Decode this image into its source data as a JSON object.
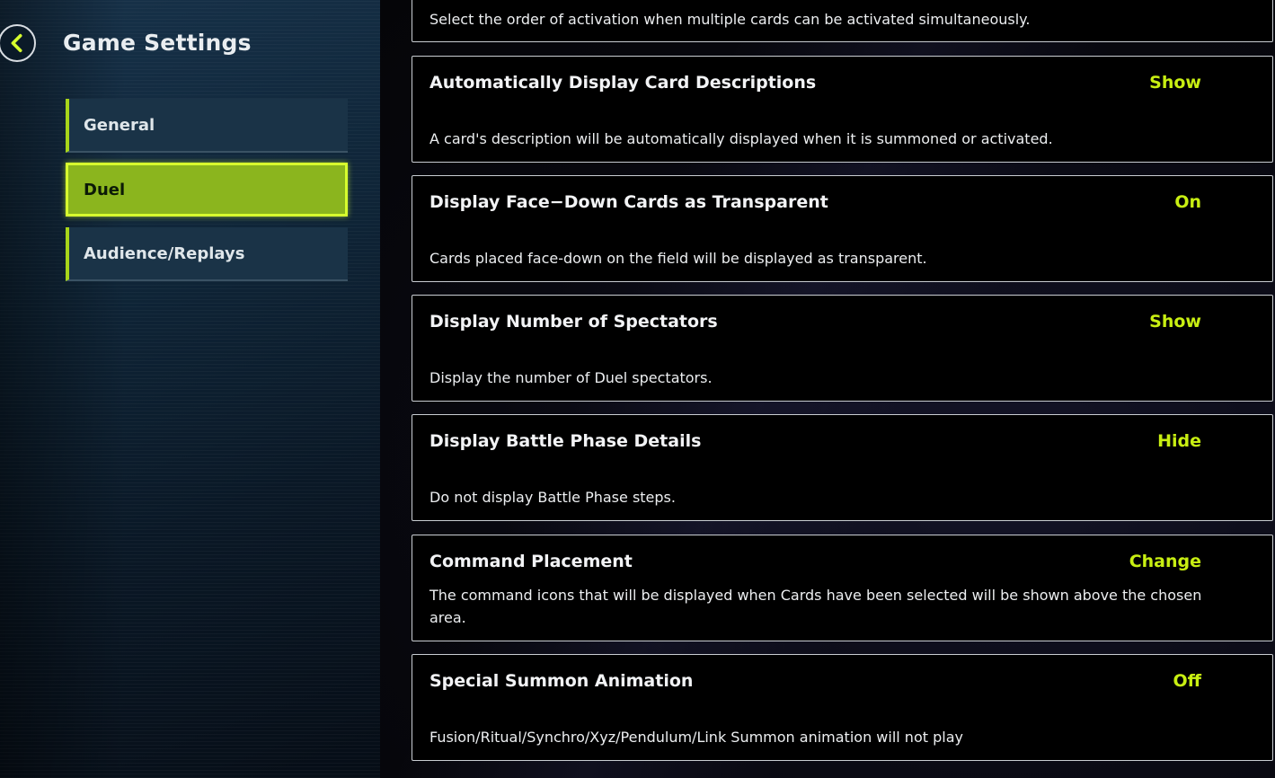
{
  "header": {
    "title": "Game Settings"
  },
  "sidebar": {
    "items": [
      {
        "label": "General",
        "active": false
      },
      {
        "label": "Duel",
        "active": true
      },
      {
        "label": "Audience/Replays",
        "active": false
      }
    ]
  },
  "settings": {
    "top_desc": "Select the order of activation when multiple cards can be activated simultaneously.",
    "items": [
      {
        "title": "Automatically Display Card Descriptions",
        "value": "Show",
        "desc": "A card's description will be automatically displayed when it is summoned or activated."
      },
      {
        "title": "Display Face−Down Cards as Transparent",
        "value": "On",
        "desc": "Cards placed face-down on the field will be displayed as transparent."
      },
      {
        "title": "Display Number of Spectators",
        "value": "Show",
        "desc": "Display the number of Duel spectators."
      },
      {
        "title": "Display Battle Phase Details",
        "value": "Hide",
        "desc": "Do not display Battle Phase steps."
      },
      {
        "title": "Command Placement",
        "value": "Change",
        "desc": "The command icons that will be displayed when Cards have been selected will be shown above the chosen area."
      },
      {
        "title": "Special Summon Animation",
        "value": "Off",
        "desc": "Fusion/Ritual/Synchro/Xyz/Pendulum/Link Summon animation will not play"
      }
    ]
  },
  "colors": {
    "accent": "#c8ef12",
    "active_tab": "#8bb51e",
    "sidebar_bg": "#0f2538"
  }
}
